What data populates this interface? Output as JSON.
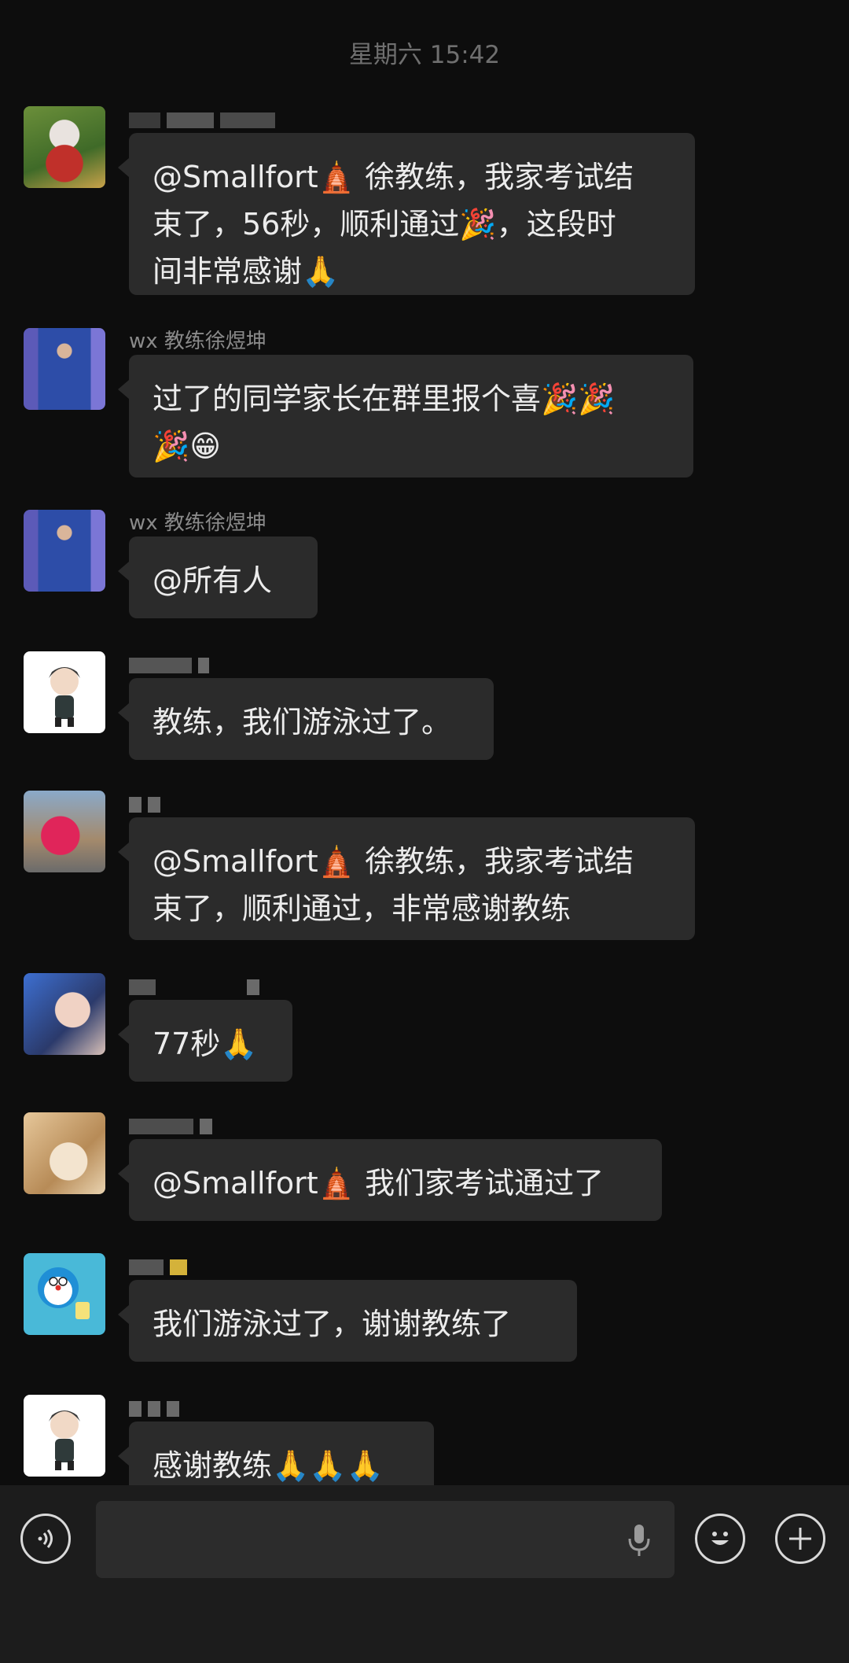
{
  "timestamp": "星期六 15:42",
  "messages": [
    {
      "sender": "",
      "text_parts": [
        "@Smallfort",
        " 徐教练，我家考试结",
        "束了，56秒，顺利通过",
        "，这段时",
        "间非常感谢"
      ],
      "emoji": [
        "🛕",
        "🎉",
        "🙏"
      ]
    },
    {
      "sender": "wx 教练徐煜坤",
      "text_parts": [
        "过了的同学家长在群里报个喜"
      ],
      "emoji": [
        "🎉🎉",
        "🎉😁"
      ]
    },
    {
      "sender": "wx 教练徐煜坤",
      "text_parts": [
        "@所有人"
      ],
      "emoji": []
    },
    {
      "sender": "",
      "text_parts": [
        "教练，我们游泳过了。"
      ],
      "emoji": []
    },
    {
      "sender": "",
      "text_parts": [
        "@Smallfort",
        " 徐教练，我家考试结",
        "束了，顺利通过，非常感谢教练"
      ],
      "emoji": [
        "🛕"
      ]
    },
    {
      "sender": "",
      "text_parts": [
        "77秒"
      ],
      "emoji": [
        "🙏"
      ]
    },
    {
      "sender": "",
      "text_parts": [
        "@Smallfort",
        " 我们家考试通过了"
      ],
      "emoji": [
        "🛕"
      ]
    },
    {
      "sender": "",
      "text_parts": [
        "我们游泳过了，谢谢教练了"
      ],
      "emoji": []
    },
    {
      "sender": "",
      "text_parts": [
        "感谢教练"
      ],
      "emoji": [
        "🙏🙏🙏"
      ]
    }
  ],
  "input": {
    "placeholder": ""
  },
  "icons": {
    "voice": "voice-icon",
    "mic": "mic-icon",
    "emoji": "emoji-face-icon",
    "plus": "plus-icon"
  }
}
